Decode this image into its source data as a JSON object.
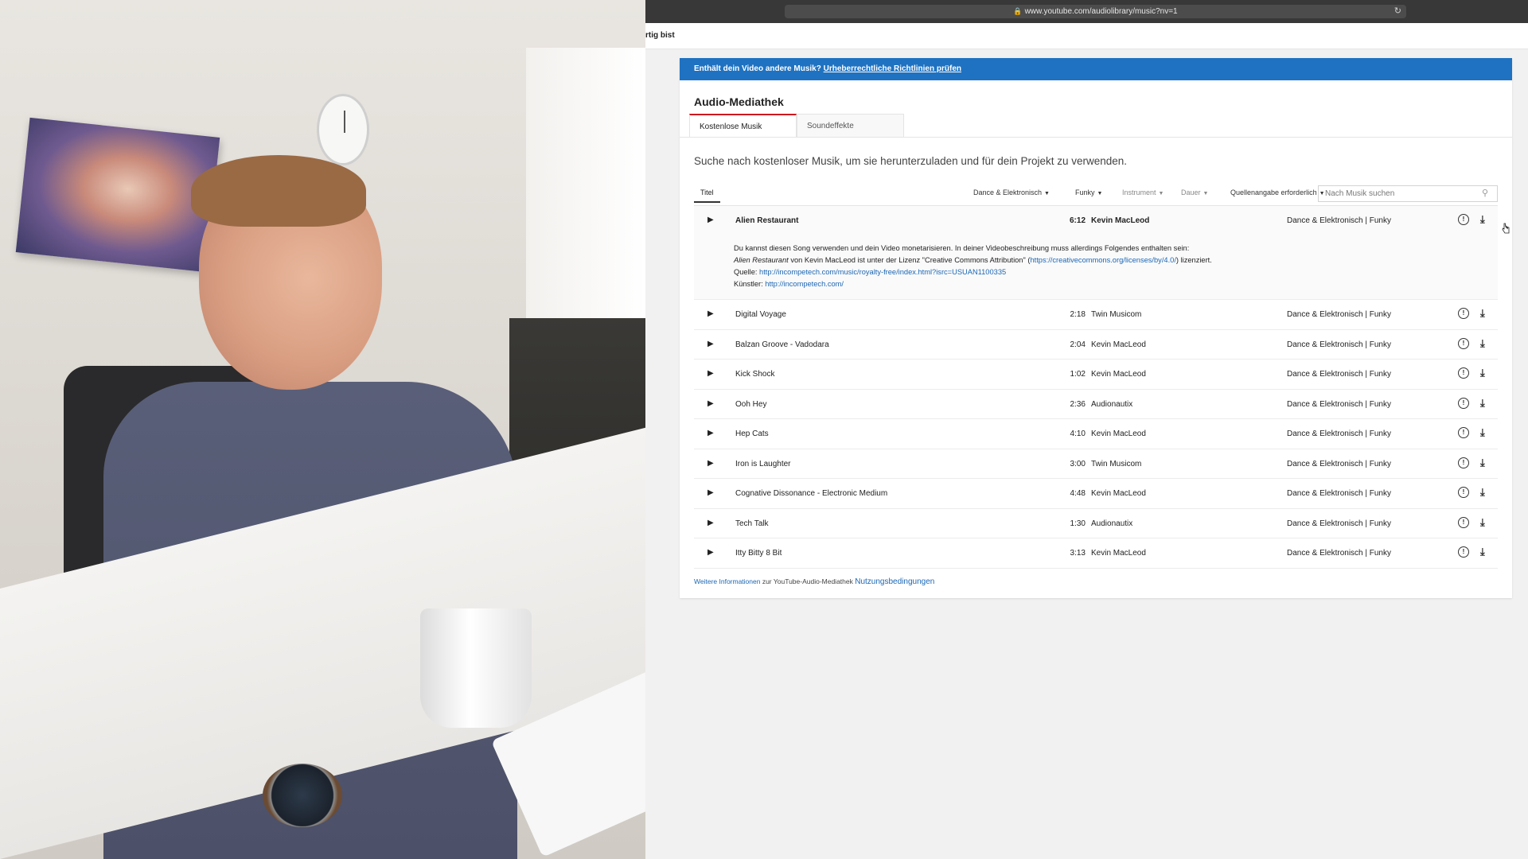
{
  "browser": {
    "url": "www.youtube.com/audiolibrary/music?nv=1",
    "page_strip_text": "rtig bist"
  },
  "notice": {
    "text": "Enthält dein Video andere Musik?",
    "link": "Urheberrechtliche Richtlinien prüfen",
    "color": "#1f72c1"
  },
  "library": {
    "title": "Audio-Mediathek",
    "tabs": [
      "Kostenlose Musik",
      "Soundeffekte"
    ],
    "intro": "Suche nach kostenloser Musik, um sie herunterzuladen und für dein Projekt zu verwenden."
  },
  "filters": {
    "title_col": "Titel",
    "genre": "Dance & Elektronisch",
    "mood": "Funky",
    "instrument": "Instrument",
    "duration": "Dauer",
    "attribution": "Quellenangabe erforderlich",
    "search_placeholder": "Nach Musik suchen"
  },
  "tracks": [
    {
      "title": "Alien Restaurant",
      "duration": "6:12",
      "artist": "Kevin MacLeod",
      "genre": "Dance & Elektronisch | Funky"
    },
    {
      "title": "Digital Voyage",
      "duration": "2:18",
      "artist": "Twin Musicom",
      "genre": "Dance & Elektronisch | Funky"
    },
    {
      "title": "Balzan Groove - Vadodara",
      "duration": "2:04",
      "artist": "Kevin MacLeod",
      "genre": "Dance & Elektronisch | Funky"
    },
    {
      "title": "Kick Shock",
      "duration": "1:02",
      "artist": "Kevin MacLeod",
      "genre": "Dance & Elektronisch | Funky"
    },
    {
      "title": "Ooh Hey",
      "duration": "2:36",
      "artist": "Audionautix",
      "genre": "Dance & Elektronisch | Funky"
    },
    {
      "title": "Hep Cats",
      "duration": "4:10",
      "artist": "Kevin MacLeod",
      "genre": "Dance & Elektronisch | Funky"
    },
    {
      "title": "Iron is Laughter",
      "duration": "3:00",
      "artist": "Twin Musicom",
      "genre": "Dance & Elektronisch | Funky"
    },
    {
      "title": "Cognative Dissonance - Electronic Medium",
      "duration": "4:48",
      "artist": "Kevin MacLeod",
      "genre": "Dance & Elektronisch | Funky"
    },
    {
      "title": "Tech Talk",
      "duration": "1:30",
      "artist": "Audionautix",
      "genre": "Dance & Elektronisch | Funky"
    },
    {
      "title": "Itty Bitty 8 Bit",
      "duration": "3:13",
      "artist": "Kevin MacLeod",
      "genre": "Dance & Elektronisch | Funky"
    }
  ],
  "expanded": {
    "line1": "Du kannst diesen Song verwenden und dein Video monetarisieren. In deiner Videobeschreibung muss allerdings Folgendes enthalten sein:",
    "song": "Alien Restaurant",
    "line2_mid": " von Kevin MacLeod ist unter der Lizenz \"Creative Commons Attribution\" (",
    "license_url": "https://creativecommons.org/licenses/by/4.0/",
    "line2_end": ") lizenziert.",
    "source_label": "Quelle: ",
    "source_url": "http://incompetech.com/music/royalty-free/index.html?isrc=USUAN1100335",
    "artist_label": "Künstler: ",
    "artist_url": "http://incompetech.com/"
  },
  "footer": {
    "more_info": "Weitere Informationen",
    "middle": " zur YouTube-Audio-Mediathek ",
    "terms": "Nutzungsbedingungen"
  }
}
